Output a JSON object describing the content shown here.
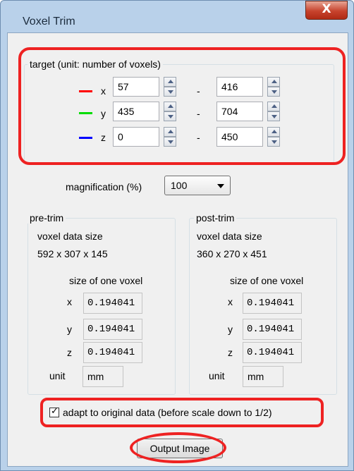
{
  "window": {
    "title": "Voxel Trim",
    "close_label": "X"
  },
  "target": {
    "group_label": "target (unit: number of voxels)",
    "rows": [
      {
        "axis": "x",
        "color": "#ff0000",
        "from": "57",
        "to": "416"
      },
      {
        "axis": "y",
        "color": "#00dd00",
        "from": "435",
        "to": "704"
      },
      {
        "axis": "z",
        "color": "#0000ff",
        "from": "0",
        "to": "450"
      }
    ],
    "range_dash": "-"
  },
  "magnification": {
    "label": "magnification (%)",
    "value": "100"
  },
  "pre_trim": {
    "group_label": "pre-trim",
    "data_size_label": "voxel data size",
    "data_size": "592 x 307 x 145",
    "voxel_size_label": "size of one voxel",
    "voxel": [
      {
        "axis": "x",
        "value": "0.194041"
      },
      {
        "axis": "y",
        "value": "0.194041"
      },
      {
        "axis": "z",
        "value": "0.194041"
      }
    ],
    "unit_label": "unit",
    "unit": "mm"
  },
  "post_trim": {
    "group_label": "post-trim",
    "data_size_label": "voxel data size",
    "data_size": "360 x 270 x 451",
    "voxel_size_label": "size of one voxel",
    "voxel": [
      {
        "axis": "x",
        "value": "0.194041"
      },
      {
        "axis": "y",
        "value": "0.194041"
      },
      {
        "axis": "z",
        "value": "0.194041"
      }
    ],
    "unit_label": "unit",
    "unit": "mm"
  },
  "adapt": {
    "checked": true,
    "label": "adapt to original data (before scale down to 1/2)"
  },
  "output_button": "Output Image",
  "colors": {
    "highlight": "#ee2222",
    "client_bg": "#f0f0f0",
    "frame": "#b9d1ea"
  }
}
